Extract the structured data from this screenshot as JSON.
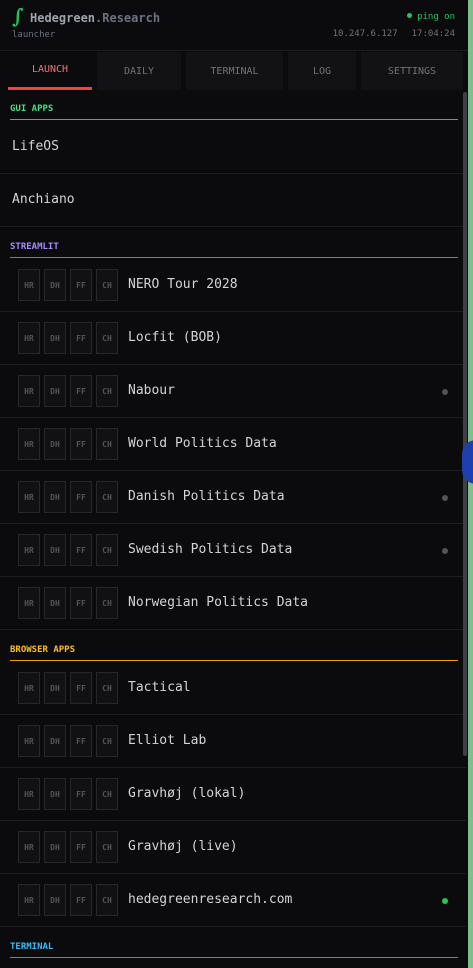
{
  "header": {
    "logo_glyph": "∫",
    "brand_primary": "Hedegreen",
    "brand_secondary": ".Research",
    "subtitle": "launcher",
    "ping_status": "ping on",
    "ip": "10.247.6.127",
    "time": "17:04:24"
  },
  "colors": {
    "accent_green": "#22c55e",
    "tab_active": "#ef4444",
    "streamlit": "#8b5cf6",
    "browser": "#f59e0b",
    "terminal": "#0ea5e9"
  },
  "tabs": [
    {
      "label": "LAUNCH",
      "active": true
    },
    {
      "label": "DAILY"
    },
    {
      "label": "TERMINAL"
    },
    {
      "label": "LOG"
    },
    {
      "label": "SETTINGS"
    }
  ],
  "buttons": [
    "HR",
    "DH",
    "FF",
    "CH"
  ],
  "sections": {
    "gui": {
      "title": "GUI APPS",
      "items": [
        {
          "label": "LifeOS"
        },
        {
          "label": "Anchiano"
        }
      ]
    },
    "streamlit": {
      "title": "STREAMLIT",
      "items": [
        {
          "label": "NERO Tour 2028",
          "status": "none"
        },
        {
          "label": "Locfit (BOB)",
          "status": "none"
        },
        {
          "label": "Nabour",
          "status": "grey"
        },
        {
          "label": "World Politics Data",
          "status": "none"
        },
        {
          "label": "Danish Politics Data",
          "status": "grey"
        },
        {
          "label": "Swedish Politics Data",
          "status": "grey"
        },
        {
          "label": "Norwegian Politics Data",
          "status": "none"
        }
      ]
    },
    "browser": {
      "title": "BROWSER APPS",
      "items": [
        {
          "label": "Tactical",
          "status": "none"
        },
        {
          "label": "Elliot Lab",
          "status": "none"
        },
        {
          "label": "Gravhøj (lokal)",
          "status": "none"
        },
        {
          "label": "Gravhøj (live)",
          "status": "none"
        },
        {
          "label": "hedegreenresearch.com",
          "status": "green"
        }
      ]
    },
    "terminal": {
      "title": "TERMINAL"
    }
  }
}
